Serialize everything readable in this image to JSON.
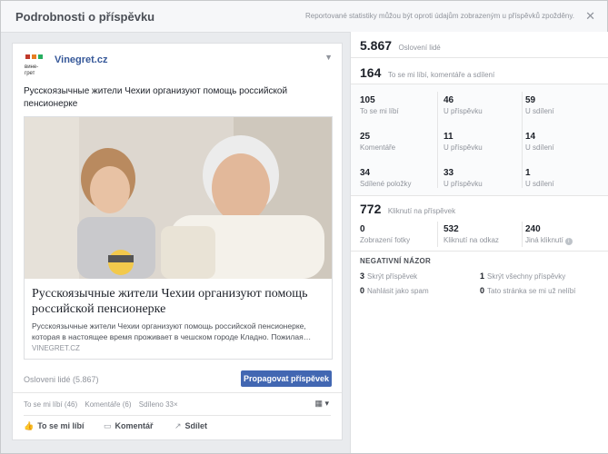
{
  "header": {
    "title": "Podrobnosti o příspěvku",
    "note": "Reportované statistiky můžou být oproti údajům zobrazeným u příspěvků zpožděny.",
    "close": "✕"
  },
  "post": {
    "page_name": "Vinegret.cz",
    "logo_text": "вине-грет",
    "text": "Русскоязычные жители Чехии организуют помощь российской пенсионерке",
    "link": {
      "title": "Русскоязычные жители Чехии организуют помощь российской пенсионерке",
      "description": "Русскоязычные жители Чехии организуют помощь российской пенсионерке, которая в настоящее время проживает в чешском городе Кладно. Пожилая…",
      "domain": "VINEGRET.CZ"
    },
    "reach_label": "Osloveni lidé (5.867)",
    "promote_label": "Propagovat příspěvek",
    "summary": {
      "likes": "To se mi líbí (46)",
      "comments": "Komentáře (6)",
      "shares": "Sdíleno 33×"
    },
    "actions": {
      "like": "To se mi líbí",
      "comment": "Komentář",
      "share": "Sdílet"
    }
  },
  "stats": {
    "reach": {
      "value": "5.867",
      "label": "Oslovení lidé"
    },
    "engagement": {
      "value": "164",
      "label": "To se mi líbí, komentáře a sdílení"
    },
    "rows": [
      [
        {
          "value": "105",
          "label": "To se mi líbí"
        },
        {
          "value": "46",
          "label": "U příspěvku"
        },
        {
          "value": "59",
          "label": "U sdílení"
        }
      ],
      [
        {
          "value": "25",
          "label": "Komentáře"
        },
        {
          "value": "11",
          "label": "U příspěvku"
        },
        {
          "value": "14",
          "label": "U sdílení"
        }
      ],
      [
        {
          "value": "34",
          "label": "Sdílené položky"
        },
        {
          "value": "33",
          "label": "U příspěvku"
        },
        {
          "value": "1",
          "label": "U sdílení"
        }
      ]
    ],
    "clicks": {
      "value": "772",
      "label": "Kliknutí na příspěvek"
    },
    "click_rows": [
      {
        "value": "0",
        "label": "Zobrazení fotky"
      },
      {
        "value": "532",
        "label": "Kliknutí na odkaz"
      },
      {
        "value": "240",
        "label": "Jiná kliknutí"
      }
    ],
    "negative": {
      "title": "NEGATIVNÍ NÁZOR",
      "items": [
        {
          "value": "3",
          "label": "Skrýt příspěvek"
        },
        {
          "value": "1",
          "label": "Skrýt všechny příspěvky"
        },
        {
          "value": "0",
          "label": "Nahlásit jako spam"
        },
        {
          "value": "0",
          "label": "Tato stránka se mi už nelíbí"
        }
      ]
    }
  }
}
